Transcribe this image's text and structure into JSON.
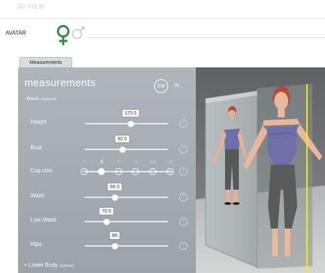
{
  "top": {
    "faint_title": "3D VIEW"
  },
  "avatar": {
    "label": "AVATAR"
  },
  "tab": {
    "label": "Measurements"
  },
  "panel": {
    "title": "measurements",
    "unit_cm": "CM",
    "unit_in": "IN",
    "basic_label": "- Basic",
    "basic_note": "(required)",
    "lower_label": "+ Lower Body",
    "lower_note": "(optional)",
    "help": "?"
  },
  "sliders": [
    {
      "label": "Height",
      "value": "175.5",
      "level": 0.55
    },
    {
      "label": "Bust",
      "value": "92.5",
      "level": 0.45
    },
    {
      "label": "Waist",
      "value": "66.5",
      "level": 0.36
    },
    {
      "label": "Low-Waist",
      "value": "70.5",
      "level": 0.26
    },
    {
      "label": "Hips",
      "value": "88",
      "level": 0.36
    }
  ],
  "cup": {
    "label": "Cup size",
    "options": [
      "A",
      "B",
      "C",
      "D",
      "DD",
      "E"
    ],
    "selected": "B"
  },
  "colors": {
    "panel": "#a5adb3",
    "accent": "#2f8a3a",
    "guide_line": "#f6f000"
  }
}
